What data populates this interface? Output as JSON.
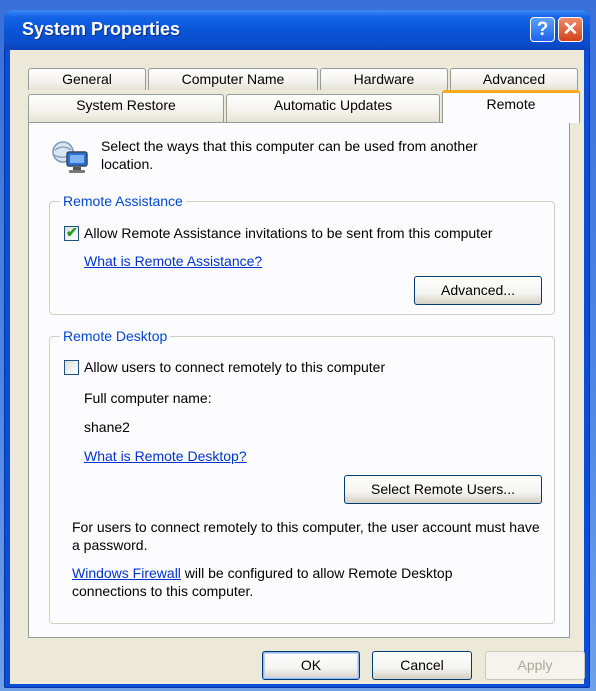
{
  "window": {
    "title": "System Properties",
    "help_glyph": "?",
    "close_glyph": "✕"
  },
  "tabs": {
    "row_back": [
      "General",
      "Computer Name",
      "Hardware",
      "Advanced"
    ],
    "row_front": [
      "System Restore",
      "Automatic Updates",
      "Remote"
    ],
    "active": "Remote"
  },
  "intro": {
    "icon": "computer-network-icon",
    "text": "Select the ways that this computer can be used from another location."
  },
  "remote_assistance": {
    "label": "Remote Assistance",
    "checkbox_label": "Allow Remote Assistance invitations to be sent from this computer",
    "checked": true,
    "help_link": "What is Remote Assistance?",
    "advanced_button": "Advanced..."
  },
  "remote_desktop": {
    "label": "Remote Desktop",
    "checkbox_label": "Allow users to connect remotely to this computer",
    "checked": false,
    "full_name_label": "Full computer name:",
    "computer_name": "shane2",
    "help_link": "What is Remote Desktop?",
    "select_users_button": "Select Remote Users...",
    "note": "For users to connect remotely to this computer, the user account must have a password.",
    "firewall_link": "Windows Firewall",
    "firewall_note": " will be configured to allow Remote Desktop connections to this computer."
  },
  "footer": {
    "ok": "OK",
    "cancel": "Cancel",
    "apply": "Apply"
  },
  "colors": {
    "title_bar": "#0a55d8",
    "active_tab_accent": "#f7a91a",
    "link": "#0033cc",
    "group_label": "#0046d5",
    "dialog_face": "#ece9d8"
  }
}
